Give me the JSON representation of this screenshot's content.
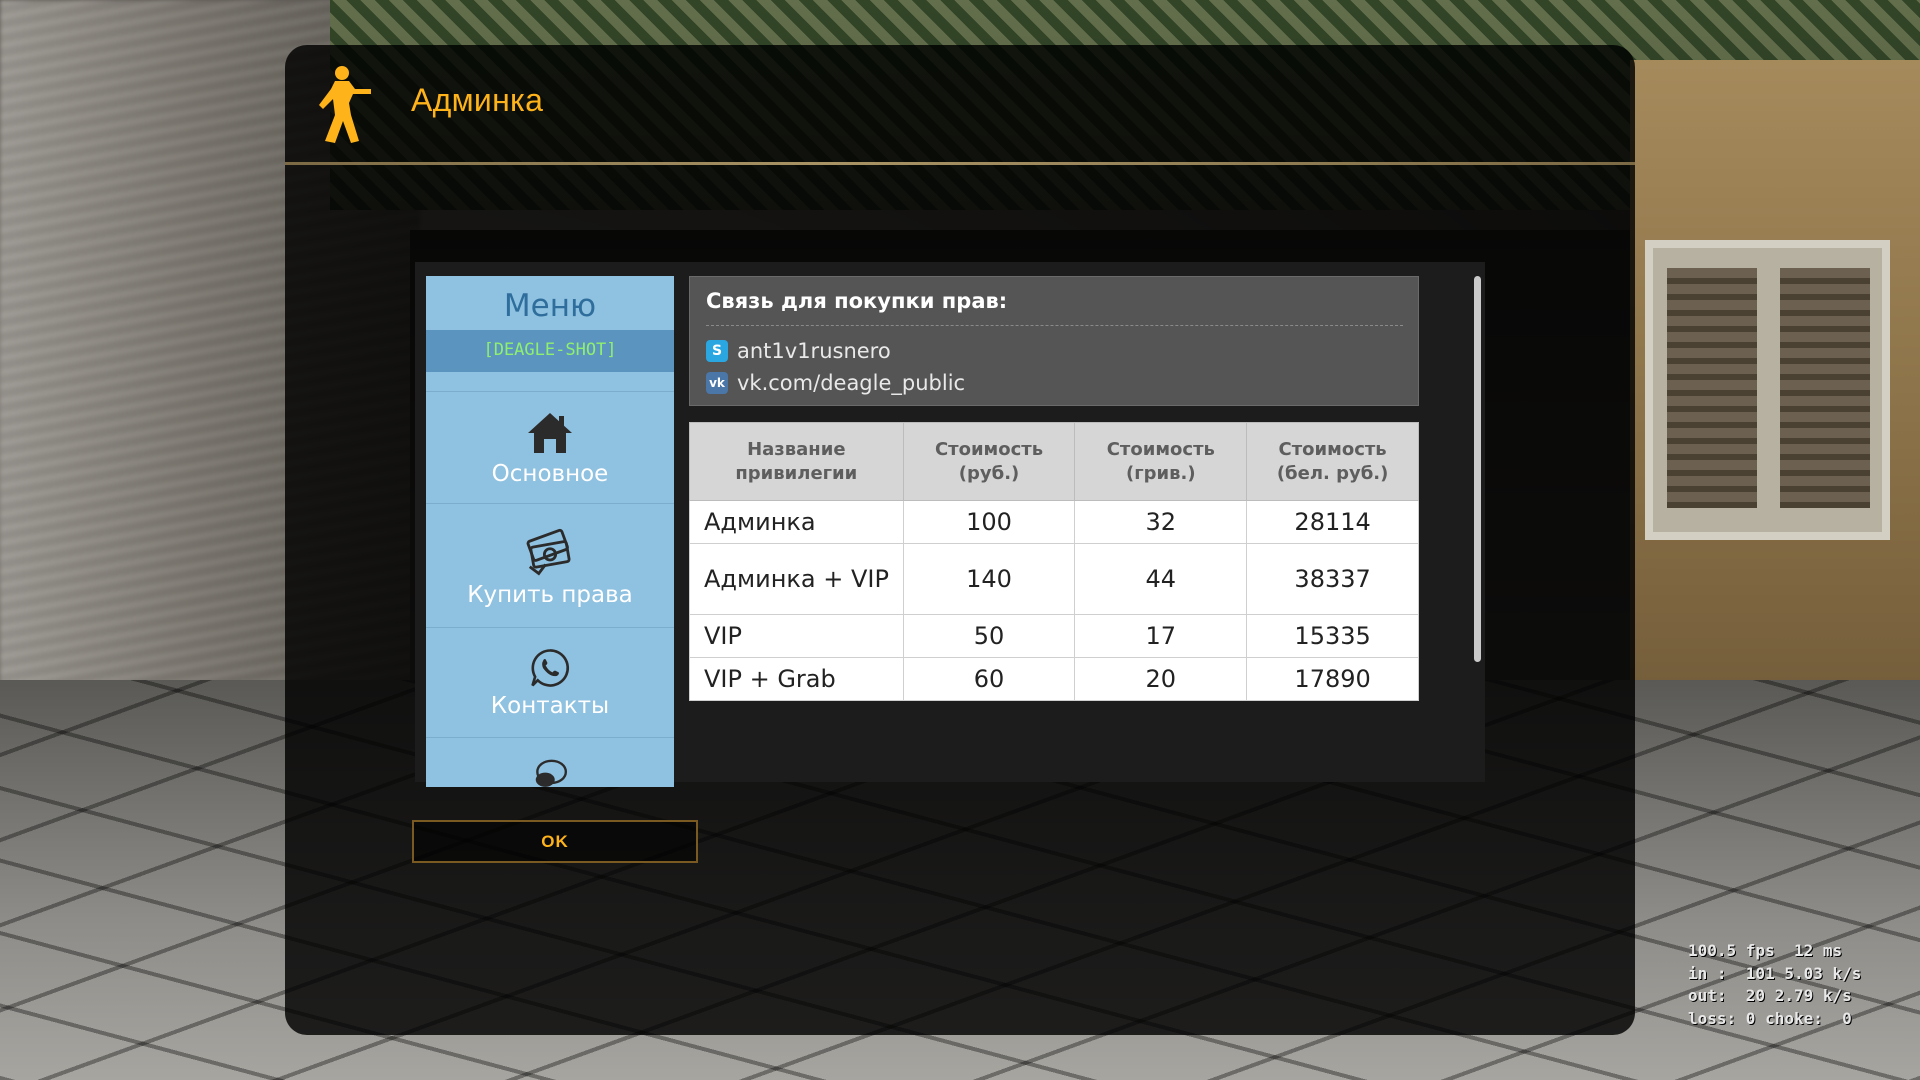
{
  "window": {
    "title": "Админка"
  },
  "menu": {
    "title": "Меню",
    "server_tag": "[DEAGLE-SHOT]",
    "items": [
      {
        "label": "Основное",
        "icon": "home-icon"
      },
      {
        "label": "Купить права",
        "icon": "money-icon"
      },
      {
        "label": "Контакты",
        "icon": "whatsapp-icon"
      },
      {
        "label": "",
        "icon": "chat-icon"
      }
    ]
  },
  "contacts": {
    "heading": "Связь для покупки прав:",
    "skype": {
      "icon": "skype-icon",
      "text": "ant1v1rusnero",
      "color": "#2aa7e0"
    },
    "vk": {
      "icon": "vk-icon",
      "text": "vk.com/deagle_public",
      "color": "#4a76a8"
    }
  },
  "price_table": {
    "headers": [
      "Название привилегии",
      "Стоимость (руб.)",
      "Стоимость (грив.)",
      "Стоимость (бел. руб.)"
    ],
    "rows": [
      {
        "name": "Админка",
        "rub": "100",
        "uah": "32",
        "byn": "28114"
      },
      {
        "name": "Админка + VIP",
        "rub": "140",
        "uah": "44",
        "byn": "38337"
      },
      {
        "name": "VIP",
        "rub": "50",
        "uah": "17",
        "byn": "15335"
      },
      {
        "name": "VIP + Grab",
        "rub": "60",
        "uah": "20",
        "byn": "17890"
      }
    ]
  },
  "ok_button": {
    "label": "OK"
  },
  "netgraph": {
    "line1": "100.5 fps  12 ms",
    "line2": "in :  101 5.03 k/s",
    "line3": "out:  20 2.79 k/s",
    "line4": "loss: 0 choke:  0"
  },
  "colors": {
    "accent": "#ffb31a",
    "menu_bg": "#8fc1e0",
    "server_tag": "#8ff06e"
  }
}
